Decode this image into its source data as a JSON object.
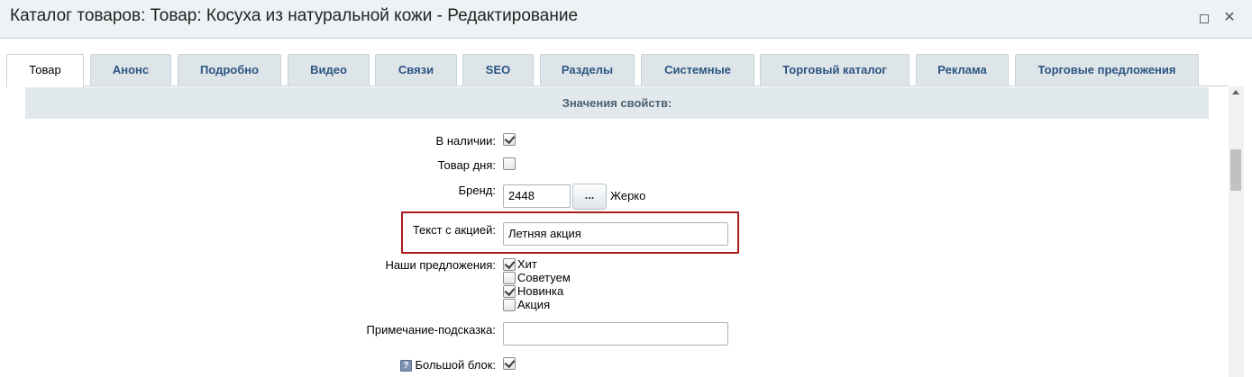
{
  "window": {
    "title": "Каталог товаров: Товар: Косуха из натуральной кожи - Редактирование",
    "close_glyph": "✕"
  },
  "tabs": [
    {
      "label": "Товар",
      "active": true
    },
    {
      "label": "Анонс"
    },
    {
      "label": "Подробно"
    },
    {
      "label": "Видео"
    },
    {
      "label": "Связи"
    },
    {
      "label": "SEO"
    },
    {
      "label": "Разделы"
    },
    {
      "label": "Системные"
    },
    {
      "label": "Торговый каталог"
    },
    {
      "label": "Реклама"
    },
    {
      "label": "Торговые предложения"
    }
  ],
  "section": {
    "title": "Значения свойств:"
  },
  "fields": {
    "in_stock": {
      "label": "В наличии:",
      "checked": true
    },
    "product_of_day": {
      "label": "Товар дня:",
      "checked": false
    },
    "brand": {
      "label": "Бренд:",
      "value": "2448",
      "button": "...",
      "name": "Жерко"
    },
    "promo_text": {
      "label": "Текст с акцией:",
      "value": "Летняя акция"
    },
    "offers": {
      "label": "Наши предложения:",
      "options": [
        {
          "label": "Хит",
          "checked": true
        },
        {
          "label": "Советуем",
          "checked": false
        },
        {
          "label": "Новинка",
          "checked": true
        },
        {
          "label": "Акция",
          "checked": false
        }
      ]
    },
    "hint_note": {
      "label": "Примечание-подсказка:",
      "value": ""
    },
    "big_block": {
      "label": "Большой блок:",
      "checked": true,
      "help_glyph": "?"
    }
  },
  "colors": {
    "highlight": "#a71d1d",
    "tab_text": "#2d5582"
  }
}
